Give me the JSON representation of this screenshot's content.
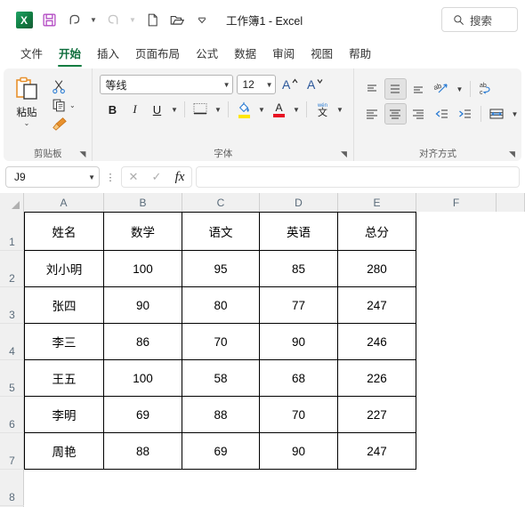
{
  "titlebar": {
    "app_icon": "excel-icon",
    "app_letter": "X",
    "document_title": "工作簿1  -  Excel",
    "quick_access": [
      {
        "name": "save-button",
        "icon": "save-icon"
      },
      {
        "name": "undo-button",
        "icon": "undo-icon"
      },
      {
        "name": "redo-button",
        "icon": "redo-icon"
      },
      {
        "name": "new-button",
        "icon": "new-document-icon"
      },
      {
        "name": "open-button",
        "icon": "open-folder-icon"
      },
      {
        "name": "customize-qat-button",
        "icon": "chevron-down-icon"
      }
    ],
    "search_placeholder": "搜索"
  },
  "ribbon_tabs": [
    {
      "label": "文件",
      "active": false
    },
    {
      "label": "开始",
      "active": true
    },
    {
      "label": "插入",
      "active": false
    },
    {
      "label": "页面布局",
      "active": false
    },
    {
      "label": "公式",
      "active": false
    },
    {
      "label": "数据",
      "active": false
    },
    {
      "label": "审阅",
      "active": false
    },
    {
      "label": "视图",
      "active": false
    },
    {
      "label": "帮助",
      "active": false
    }
  ],
  "ribbon": {
    "clipboard": {
      "group_label": "剪贴板",
      "paste_label": "粘贴",
      "cut_label": "剪切",
      "copy_label": "复制",
      "format_painter_label": "格式刷"
    },
    "font": {
      "group_label": "字体",
      "font_name": "等线",
      "font_size": "12",
      "grow_font": "A",
      "shrink_font": "A",
      "bold": "B",
      "italic": "I",
      "underline": "U",
      "phonetic": "文"
    },
    "alignment": {
      "group_label": "对齐方式"
    }
  },
  "formula_bar": {
    "name_box_value": "J9",
    "cancel_icon": "cancel-icon",
    "enter_icon": "check-icon",
    "function_icon": "fx",
    "formula_value": ""
  },
  "grid": {
    "column_headers": [
      "A",
      "B",
      "C",
      "D",
      "E",
      "F"
    ],
    "row_headers": [
      "1",
      "2",
      "3",
      "4",
      "5",
      "6",
      "7",
      "8"
    ],
    "table_headers": [
      "姓名",
      "数学",
      "语文",
      "英语",
      "总分"
    ],
    "rows": [
      [
        "刘小明",
        "100",
        "95",
        "85",
        "280"
      ],
      [
        "张四",
        "90",
        "80",
        "77",
        "247"
      ],
      [
        "李三",
        "86",
        "70",
        "90",
        "246"
      ],
      [
        "王五",
        "100",
        "58",
        "68",
        "226"
      ],
      [
        "李明",
        "69",
        "88",
        "70",
        "227"
      ],
      [
        "周艳",
        "88",
        "69",
        "90",
        "247"
      ]
    ]
  },
  "colors": {
    "excel_green": "#107c41",
    "active_tab": "#0f6e3d",
    "save_purple": "#b146c2",
    "fill_yellow": "#ffe600",
    "font_red": "#e81123",
    "header_gray": "#f0f0f0"
  }
}
